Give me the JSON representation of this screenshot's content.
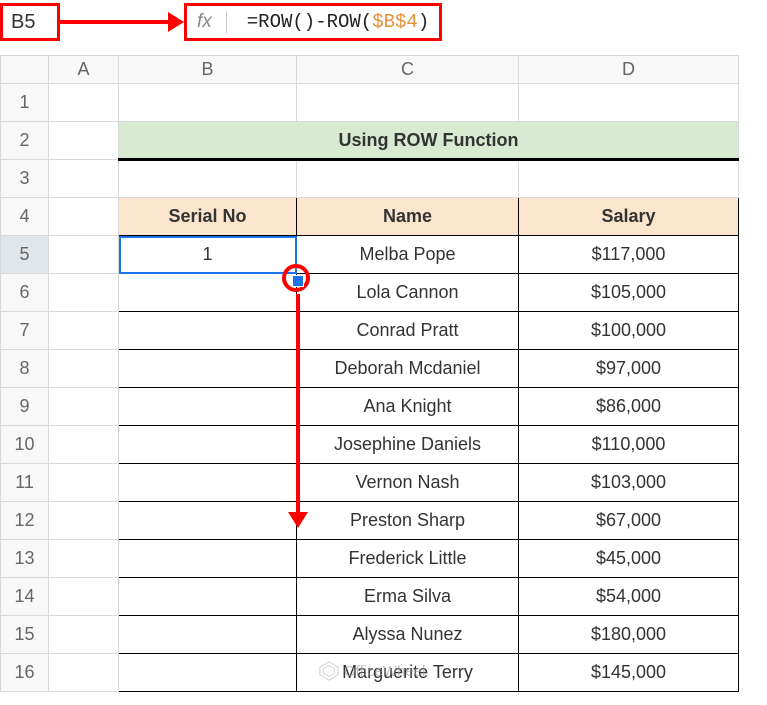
{
  "cellRef": "B5",
  "fxLabel": "fx",
  "formulaPrefix": "=ROW()-ROW(",
  "formulaRef": "$B$4",
  "formulaSuffix": ")",
  "columns": {
    "A": "A",
    "B": "B",
    "C": "C",
    "D": "D"
  },
  "rows": [
    "1",
    "2",
    "3",
    "4",
    "5",
    "6",
    "7",
    "8",
    "9",
    "10",
    "11",
    "12",
    "13",
    "14",
    "15",
    "16"
  ],
  "title": "Using ROW Function",
  "headers": {
    "serial": "Serial No",
    "name": "Name",
    "salary": "Salary"
  },
  "data": [
    {
      "serial": "1",
      "name": "Melba Pope",
      "salary": "$117,000"
    },
    {
      "serial": "",
      "name": "Lola Cannon",
      "salary": "$105,000"
    },
    {
      "serial": "",
      "name": "Conrad Pratt",
      "salary": "$100,000"
    },
    {
      "serial": "",
      "name": "Deborah Mcdaniel",
      "salary": "$97,000"
    },
    {
      "serial": "",
      "name": "Ana Knight",
      "salary": "$86,000"
    },
    {
      "serial": "",
      "name": "Josephine Daniels",
      "salary": "$110,000"
    },
    {
      "serial": "",
      "name": "Vernon Nash",
      "salary": "$103,000"
    },
    {
      "serial": "",
      "name": "Preston Sharp",
      "salary": "$67,000"
    },
    {
      "serial": "",
      "name": "Frederick Little",
      "salary": "$45,000"
    },
    {
      "serial": "",
      "name": "Erma Silva",
      "salary": "$54,000"
    },
    {
      "serial": "",
      "name": "Alyssa Nunez",
      "salary": "$180,000"
    },
    {
      "serial": "",
      "name": "Marguerite Terry",
      "salary": "$145,000"
    }
  ],
  "watermark": "OfficeWheel"
}
